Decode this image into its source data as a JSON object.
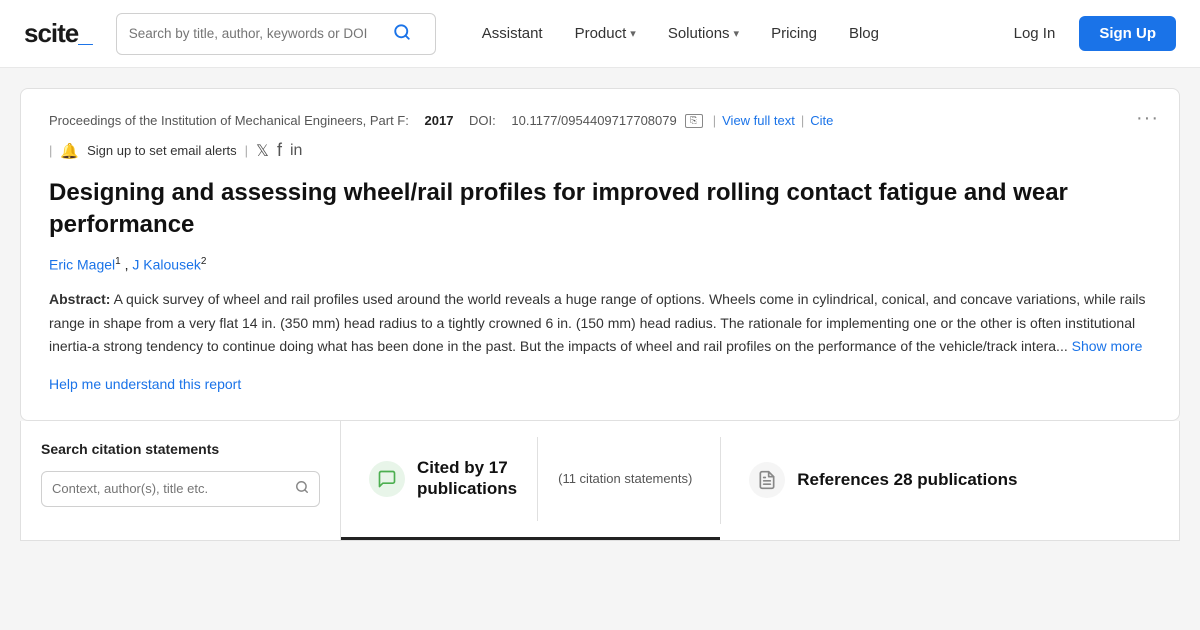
{
  "logo": {
    "text": "scite",
    "underscore": "_"
  },
  "navbar": {
    "search_placeholder": "Search by title, author, keywords or DOI",
    "items": [
      {
        "label": "Assistant",
        "has_dropdown": false
      },
      {
        "label": "Product",
        "has_dropdown": true
      },
      {
        "label": "Solutions",
        "has_dropdown": true
      },
      {
        "label": "Pricing",
        "has_dropdown": false
      },
      {
        "label": "Blog",
        "has_dropdown": false
      }
    ],
    "login_label": "Log In",
    "signup_label": "Sign Up"
  },
  "article": {
    "journal": "Proceedings of the Institution of Mechanical Engineers, Part F:",
    "year": "2017",
    "doi_label": "DOI:",
    "doi": "10.1177/0954409717708079",
    "view_full_text": "View full text",
    "cite_label": "Cite",
    "alerts_label": "Sign up to set email alerts",
    "title": "Designing and assessing wheel/rail profiles for improved rolling contact fatigue and wear performance",
    "authors": [
      {
        "name": "Eric Magel",
        "superscript": "1"
      },
      {
        "name": "J Kalousek",
        "superscript": "2"
      }
    ],
    "abstract_label": "Abstract:",
    "abstract_text": "A quick survey of wheel and rail profiles used around the world reveals a huge range of options. Wheels come in cylindrical, conical, and concave variations, while rails range in shape from a very flat 14 in. (350 mm) head radius to a tightly crowned 6 in. (150 mm) head radius. The rationale for implementing one or the other is often institutional inertia-a strong tendency to continue doing what has been done in the past. But the impacts of wheel and rail profiles on the performance of the vehicle/track intera...",
    "show_more": "Show more",
    "help_link": "Help me understand this report"
  },
  "citations": {
    "search_label": "Search citation statements",
    "search_placeholder": "Context, author(s), title etc.",
    "cited_by_label": "Cited by 17",
    "cited_by_line2": "publications",
    "citation_statements": "(11 citation statements)",
    "references_label": "References 28 publications"
  }
}
